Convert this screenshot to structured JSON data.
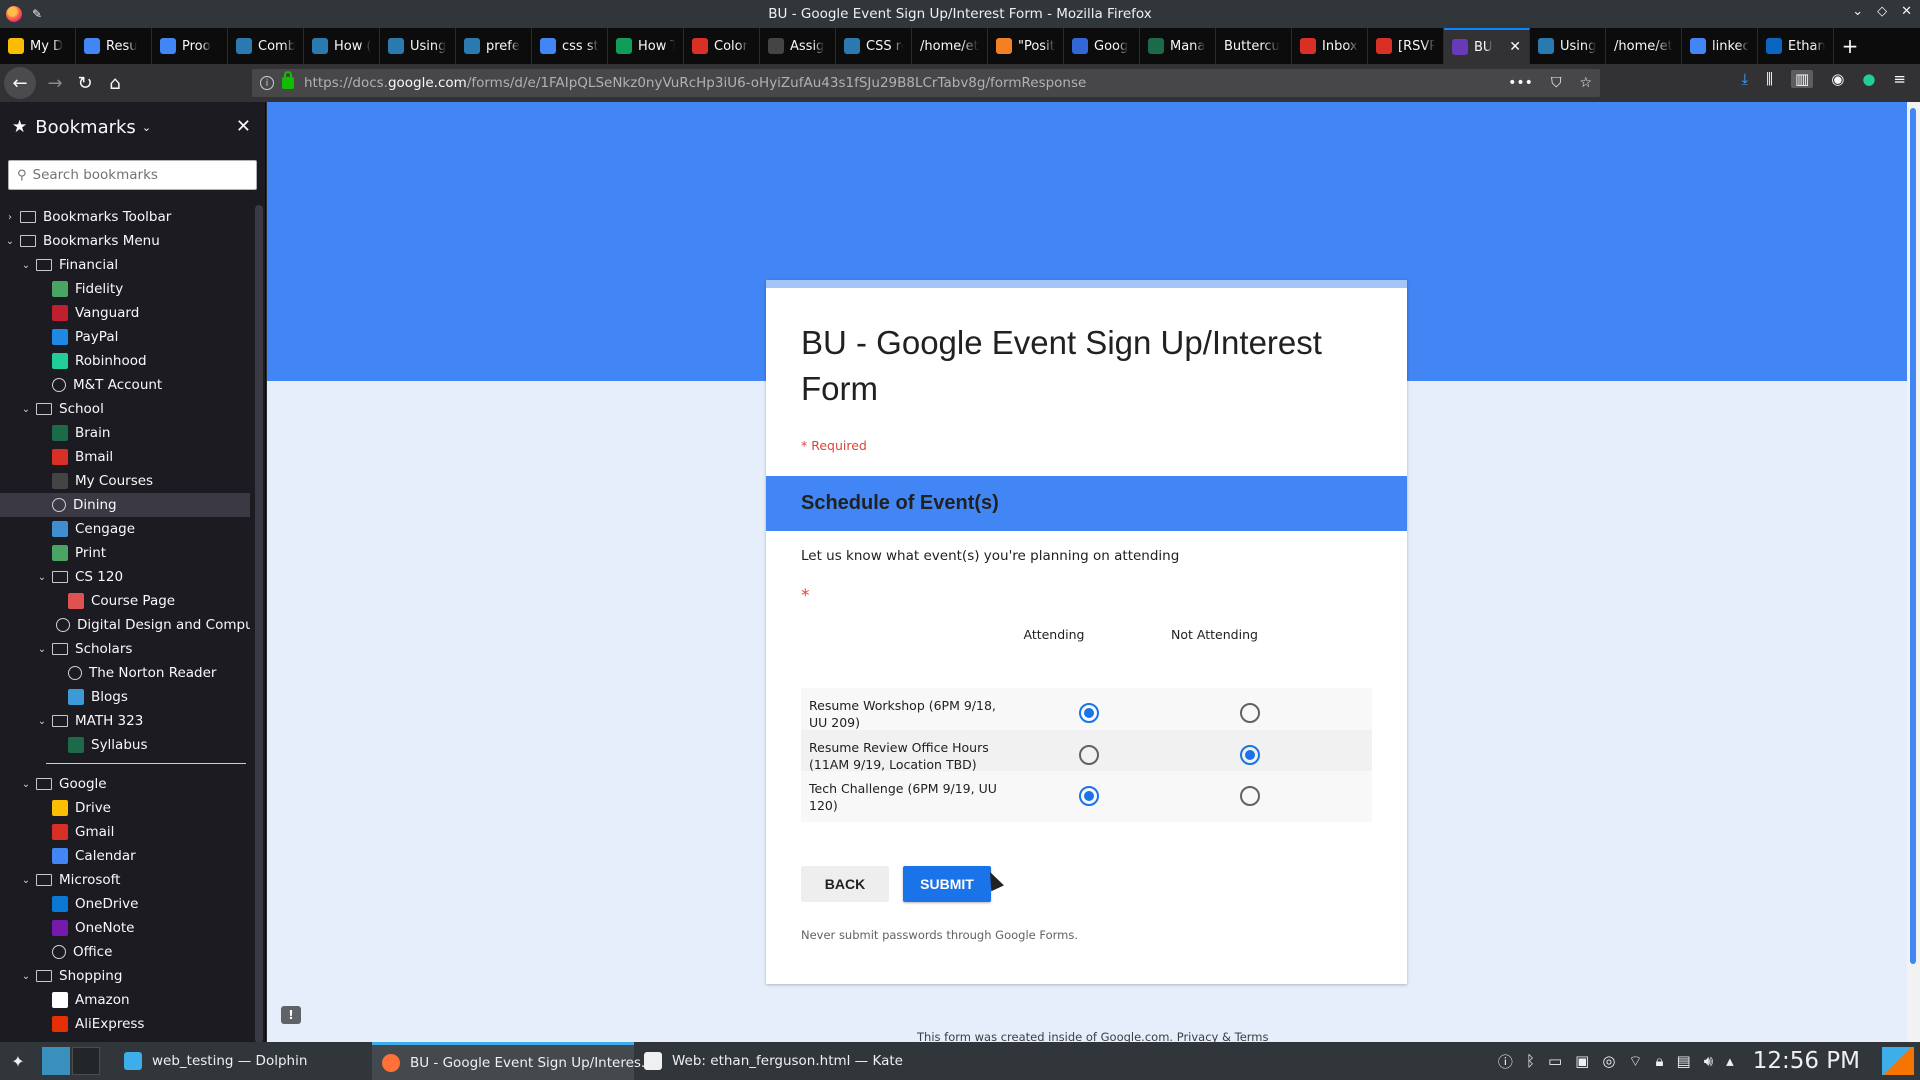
{
  "window": {
    "title": "BU - Google Event Sign Up/Interest Form - Mozilla Firefox"
  },
  "tabs": [
    {
      "label": "My D",
      "icon": "drive-icon",
      "color": "#fbbc04"
    },
    {
      "label": "Resu",
      "icon": "docs-icon",
      "color": "#4285f4"
    },
    {
      "label": "Proo",
      "icon": "docs-icon",
      "color": "#4285f4"
    },
    {
      "label": "Comb",
      "icon": "github-icon",
      "color": "#2a7ab0"
    },
    {
      "label": "How (",
      "icon": "github-icon",
      "color": "#2a7ab0"
    },
    {
      "label": "Using",
      "icon": "github-icon",
      "color": "#2a7ab0"
    },
    {
      "label": "prefe",
      "icon": "github-icon",
      "color": "#2a7ab0"
    },
    {
      "label": "css st",
      "icon": "google-icon",
      "color": "#4285f4"
    },
    {
      "label": "How T",
      "icon": "sheets-icon",
      "color": "#0f9d58"
    },
    {
      "label": "Color",
      "icon": "gmail-icon",
      "color": "#d93025"
    },
    {
      "label": "Assig",
      "icon": "blackboard-icon",
      "color": "#444444"
    },
    {
      "label": "CSS re",
      "icon": "github-icon",
      "color": "#2a7ab0"
    },
    {
      "label": "/home/et",
      "icon": "none",
      "color": ""
    },
    {
      "label": "\"Posit",
      "icon": "stackoverflow-icon",
      "color": "#f48024"
    },
    {
      "label": "Goog",
      "icon": "scribd-icon",
      "color": "#3367d6"
    },
    {
      "label": "Mana",
      "icon": "h-icon",
      "color": "#1b6b4a"
    },
    {
      "label": "Buttercu",
      "icon": "none",
      "color": ""
    },
    {
      "label": "Inbox",
      "icon": "gmail-icon",
      "color": "#d93025"
    },
    {
      "label": "[RSVP",
      "icon": "gmail-icon",
      "color": "#d93025"
    },
    {
      "label": "BU",
      "icon": "forms-icon",
      "color": "#673ab7",
      "active": true
    },
    {
      "label": "Using",
      "icon": "github-icon",
      "color": "#2a7ab0"
    },
    {
      "label": "/home/et",
      "icon": "none",
      "color": ""
    },
    {
      "label": "linkec",
      "icon": "google-icon",
      "color": "#4285f4"
    },
    {
      "label": "Ethan",
      "icon": "linkedin-icon",
      "color": "#0a66c2"
    }
  ],
  "nav": {
    "url_prefix": "https://docs.",
    "url_host": "google.com",
    "url_path": "/forms/d/e/1FAIpQLSeNkz0nyVuRcHp3iU6-oHyiZufAu43s1fSJu29B8LCrTabv8g/formResponse"
  },
  "sidebar": {
    "title": "Bookmarks",
    "search_placeholder": "Search bookmarks",
    "items": [
      {
        "label": "Bookmarks Toolbar",
        "level": 0,
        "kind": "folder-special",
        "twisty": "closed"
      },
      {
        "label": "Bookmarks Menu",
        "level": 0,
        "kind": "folder-special",
        "twisty": "open"
      },
      {
        "label": "Financial",
        "level": 1,
        "kind": "folder",
        "twisty": "open"
      },
      {
        "label": "Fidelity",
        "level": 2,
        "kind": "fidelity",
        "color": "#4aa564"
      },
      {
        "label": "Vanguard",
        "level": 2,
        "kind": "vanguard",
        "color": "#c01f2f"
      },
      {
        "label": "PayPal",
        "level": 2,
        "kind": "paypal",
        "color": "#1e88e5"
      },
      {
        "label": "Robinhood",
        "level": 2,
        "kind": "robinhood",
        "color": "#21ce99"
      },
      {
        "label": "M&T Account",
        "level": 2,
        "kind": "globe"
      },
      {
        "label": "School",
        "level": 1,
        "kind": "folder",
        "twisty": "open"
      },
      {
        "label": "Brain",
        "level": 2,
        "kind": "binghamton",
        "color": "#1b6b4a"
      },
      {
        "label": "Bmail",
        "level": 2,
        "kind": "gmail",
        "color": "#d93025"
      },
      {
        "label": "My Courses",
        "level": 2,
        "kind": "blackboard",
        "color": "#444444"
      },
      {
        "label": "Dining",
        "level": 2,
        "kind": "globe",
        "selected": true
      },
      {
        "label": "Cengage",
        "level": 2,
        "kind": "cengage",
        "color": "#3e8ed0"
      },
      {
        "label": "Print",
        "level": 2,
        "kind": "print",
        "color": "#4aa564"
      },
      {
        "label": "CS 120",
        "level": 2,
        "kind": "folder",
        "twisty": "open"
      },
      {
        "label": "Course Page",
        "level": 3,
        "kind": "coursepage",
        "color": "#e05252"
      },
      {
        "label": "Digital Design and Compu...",
        "level": 3,
        "kind": "globe"
      },
      {
        "label": "Scholars",
        "level": 2,
        "kind": "folder",
        "twisty": "open"
      },
      {
        "label": "The Norton Reader",
        "level": 3,
        "kind": "globe"
      },
      {
        "label": "Blogs",
        "level": 3,
        "kind": "wordpress",
        "color": "#3c9ad8"
      },
      {
        "label": "MATH 323",
        "level": 2,
        "kind": "folder",
        "twisty": "open"
      },
      {
        "label": "Syllabus",
        "level": 3,
        "kind": "binghamton",
        "color": "#1b6b4a"
      },
      {
        "label": "",
        "kind": "separator"
      },
      {
        "label": "Google",
        "level": 1,
        "kind": "folder",
        "twisty": "open"
      },
      {
        "label": "Drive",
        "level": 2,
        "kind": "drive",
        "color": "#fbbc04"
      },
      {
        "label": "Gmail",
        "level": 2,
        "kind": "gmail",
        "color": "#d93025"
      },
      {
        "label": "Calendar",
        "level": 2,
        "kind": "calendar",
        "color": "#4285f4"
      },
      {
        "label": "Microsoft",
        "level": 1,
        "kind": "folder",
        "twisty": "open"
      },
      {
        "label": "OneDrive",
        "level": 2,
        "kind": "onedrive",
        "color": "#0a78d4"
      },
      {
        "label": "OneNote",
        "level": 2,
        "kind": "onenote",
        "color": "#7719aa"
      },
      {
        "label": "Office",
        "level": 2,
        "kind": "globe"
      },
      {
        "label": "Shopping",
        "level": 1,
        "kind": "folder",
        "twisty": "open"
      },
      {
        "label": "Amazon",
        "level": 2,
        "kind": "amazon",
        "color": "#ffffff"
      },
      {
        "label": "AliExpress",
        "level": 2,
        "kind": "aliexpress",
        "color": "#e62e04"
      }
    ]
  },
  "form": {
    "title": "BU - Google Event Sign Up/Interest Form",
    "required_note": "* Required",
    "section_title": "Schedule of Event(s)",
    "description": "Let us know what event(s) you're planning on attending",
    "required_star": "*",
    "columns": [
      "Attending",
      "Not Attending"
    ],
    "rows": [
      {
        "label": "Resume Workshop (6PM 9/18, UU 209)",
        "selected": 0
      },
      {
        "label": "Resume Review Office Hours (11AM 9/19, Location TBD)",
        "selected": 1
      },
      {
        "label": "Tech Challenge (6PM 9/19, UU 120)",
        "selected": 0
      }
    ],
    "back_label": "BACK",
    "submit_label": "SUBMIT",
    "warning": "Never submit passwords through Google Forms.",
    "footer_text": "This form was created inside of Google.com.",
    "footer_link": "Privacy & Terms"
  },
  "taskbar": {
    "tasks": [
      {
        "label": "web_testing — Dolphin",
        "icon": "folder-icon",
        "color": "#3daee9"
      },
      {
        "label": "BU - Google Event Sign Up/Interes...",
        "icon": "firefox-icon",
        "color": "#ff7139",
        "active": true
      },
      {
        "label": "Web: ethan_ferguson.html — Kate",
        "icon": "kate-icon",
        "color": "#eff0f1"
      }
    ],
    "clock": "12:56 PM"
  }
}
